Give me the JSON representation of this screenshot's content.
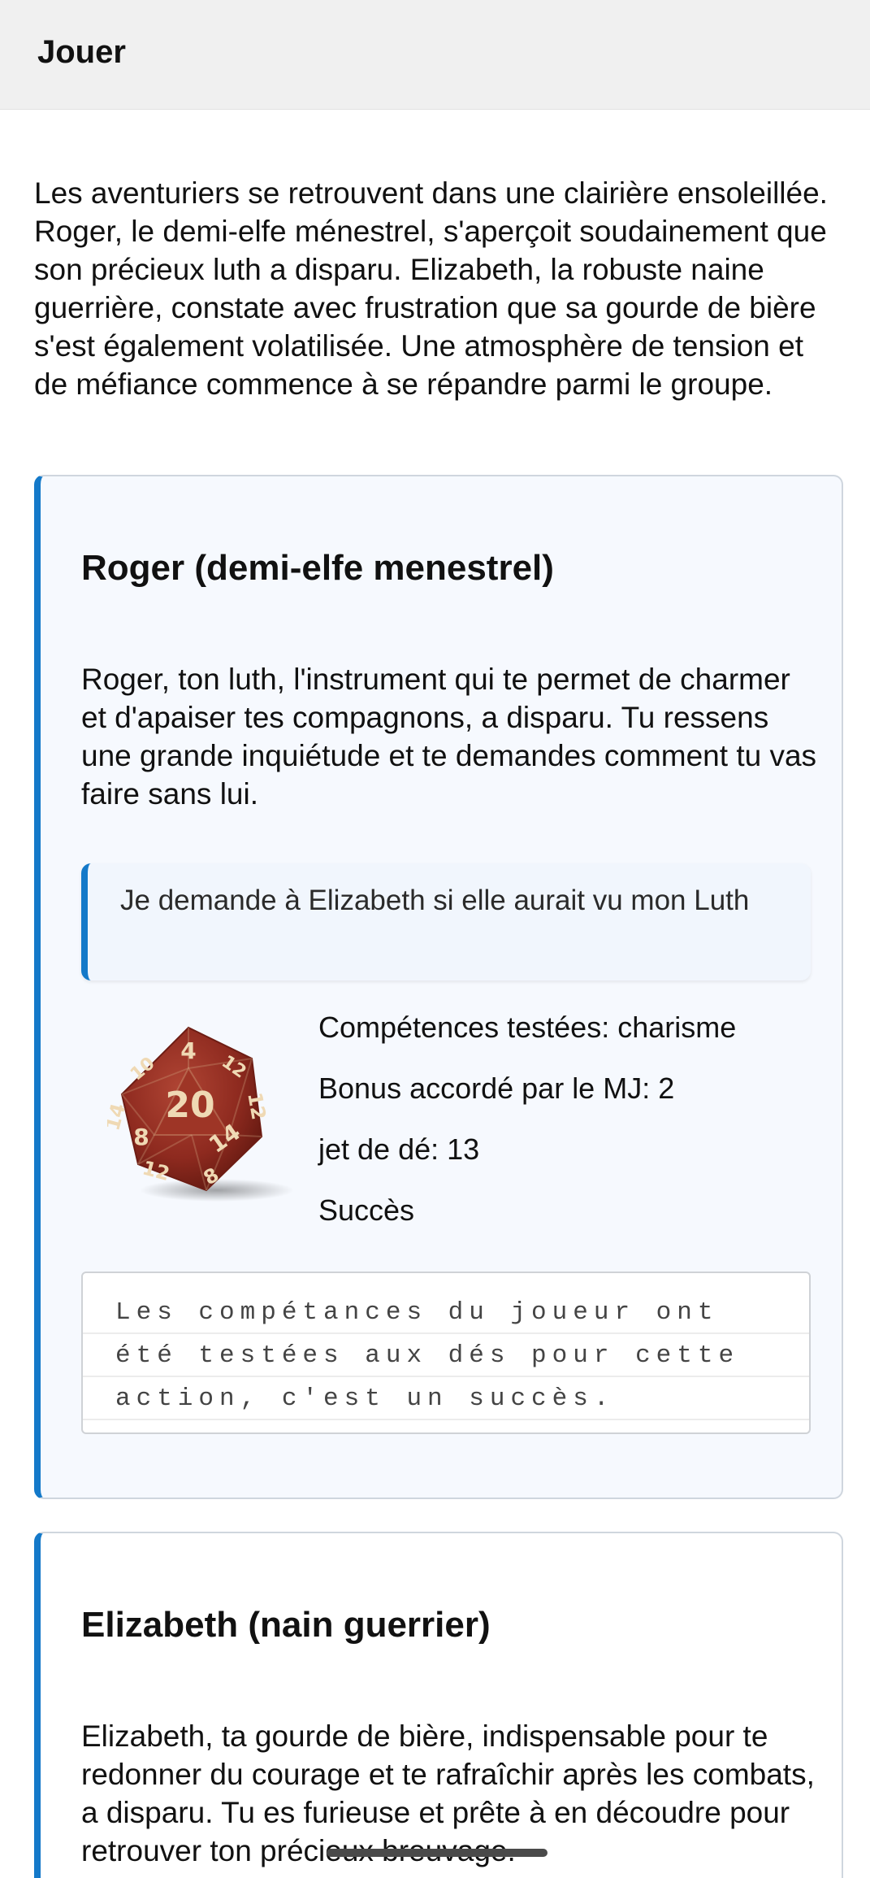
{
  "header": {
    "title": "Jouer"
  },
  "intro": {
    "text": "Les aventuriers se retrouvent dans une clairière ensoleillée. Roger, le demi-elfe ménestrel, s'aperçoit soudainement que son précieux luth a disparu. Elizabeth, la robuste naine guerrière, constate avec frustration que sa gourde de bière s'est également volatilisée. Une atmosphère de tension et de méfiance commence à se répandre parmi le groupe."
  },
  "turns": [
    {
      "character": "Roger (demi-elfe menestrel)",
      "narration": "Roger, ton luth, l'instrument qui te permet de charmer et d'apaiser tes compagnons, a disparu. Tu ressens une grande inquiétude et te demandes comment tu vas faire sans lui.",
      "player_action": "Je demande à Elizabeth si elle aurait vu mon Luth",
      "dice": {
        "icon": "d20-die-icon",
        "color": "#8e2a1f",
        "numbers": [
          "20",
          "4",
          "14",
          "8",
          "12",
          "8",
          "12",
          "14",
          "10",
          "12"
        ]
      },
      "stats": {
        "skills": "Compétences testées: charisme",
        "gm_bonus": "Bonus accordé par le MJ: 2",
        "roll": "jet de dé: 13",
        "result": "Succès"
      },
      "gm_note": "Les compétances du joueur ont été testées aux dés pour cette action, c'est un succès."
    },
    {
      "character": "Elizabeth (nain guerrier)",
      "narration": "Elizabeth, ta gourde de bière, indispensable pour te redonner du courage et te rafraîchir après les combats, a disparu. Tu es furieuse et prête à en découdre pour retrouver ton précieux breuvage."
    }
  ],
  "colors": {
    "accent": "#1479c9",
    "card_background": "#f6f9fe",
    "header_background": "#f0f0f0"
  }
}
